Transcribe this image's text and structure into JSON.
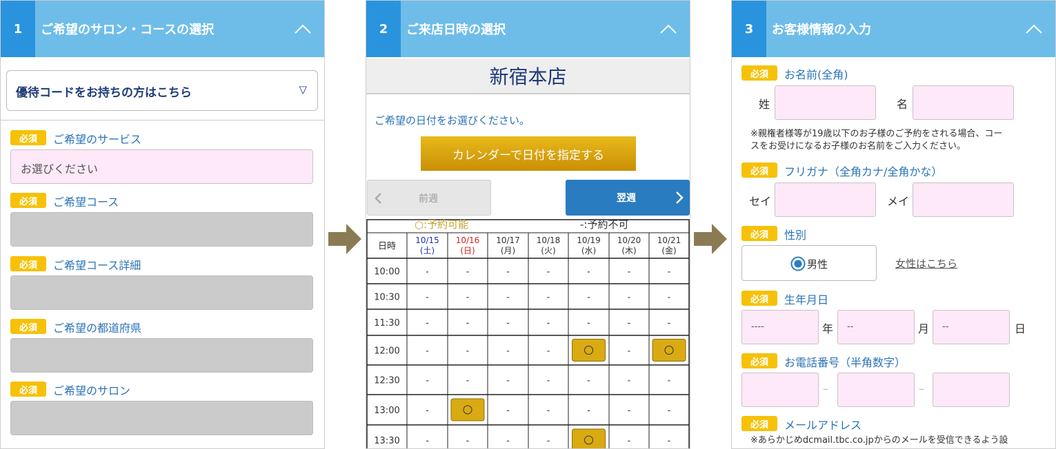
{
  "panel1": {
    "step": "1",
    "title": "ご希望のサロン・コースの選択",
    "promo_label": "優待コードをお持ちの方はこちら",
    "promo_caret": "▽",
    "required": "必須",
    "fields": [
      {
        "label": "ご希望のサービス",
        "value": "お選びください"
      },
      {
        "label": "ご希望コース",
        "value": ""
      },
      {
        "label": "ご希望コース詳細",
        "value": ""
      },
      {
        "label": "ご希望の都道府県",
        "value": ""
      },
      {
        "label": "ご希望のサロン",
        "value": ""
      }
    ]
  },
  "panel2": {
    "step": "2",
    "title": "ご来店日時の選択",
    "store": "新宿本店",
    "instruction": "ご希望の日付をお選びください。",
    "calendar_button": "カレンダーで日付を指定する",
    "prev_week": "前週",
    "next_week": "翌週",
    "legend_available": "○:予約可能",
    "legend_unavailable": "-:予約不可",
    "time_header": "日時",
    "days": [
      {
        "date": "10/15",
        "dow": "(土)"
      },
      {
        "date": "10/16",
        "dow": "(日)"
      },
      {
        "date": "10/17",
        "dow": "(月)"
      },
      {
        "date": "10/18",
        "dow": "(火)"
      },
      {
        "date": "10/19",
        "dow": "(水)"
      },
      {
        "date": "10/20",
        "dow": "(木)"
      },
      {
        "date": "10/21",
        "dow": "(金)"
      }
    ],
    "unavailable_mark": "-",
    "slots": [
      {
        "time": "10:00",
        "open": []
      },
      {
        "time": "10:30",
        "open": []
      },
      {
        "time": "11:30",
        "open": []
      },
      {
        "time": "12:00",
        "open": [
          4,
          6
        ]
      },
      {
        "time": "12:30",
        "open": []
      },
      {
        "time": "13:00",
        "open": [
          1
        ]
      },
      {
        "time": "13:30",
        "open": [
          4
        ]
      }
    ]
  },
  "panel3": {
    "step": "3",
    "title": "お客様情報の入力",
    "required": "必須",
    "name_label": "お名前(全角)",
    "last_name": "姓",
    "first_name": "名",
    "name_note_1": "※親権者様等が19歳以下のお子様のご予約をされる場合、コー",
    "name_note_2": "スをお受けになるお子様のお名前をご入力ください。",
    "kana_label": "フリガナ（全角カナ/全角かな）",
    "kana_last": "セイ",
    "kana_first": "メイ",
    "gender_label": "性別",
    "gender_selected": "男性",
    "gender_female_link": "女性はこちら",
    "birth_label": "生年月日",
    "year_placeholder": "----",
    "month_placeholder": "--",
    "day_placeholder": "--",
    "year_unit": "年",
    "month_unit": "月",
    "day_unit": "日",
    "phone_label": "お電話番号（半角数字）",
    "phone_sep": "–",
    "email_label": "メールアドレス",
    "email_note": "※あらかじめdcmail.tbc.co.jpからのメールを受信できるよう設"
  },
  "colors": {
    "header": "#6ebde9",
    "step": "#2a93dd",
    "badge": "#f6c107",
    "field_pink": "#fde9f8",
    "gold": "#d9aa12",
    "next_button": "#2a7cc0",
    "arrow": "#8b7b55"
  }
}
